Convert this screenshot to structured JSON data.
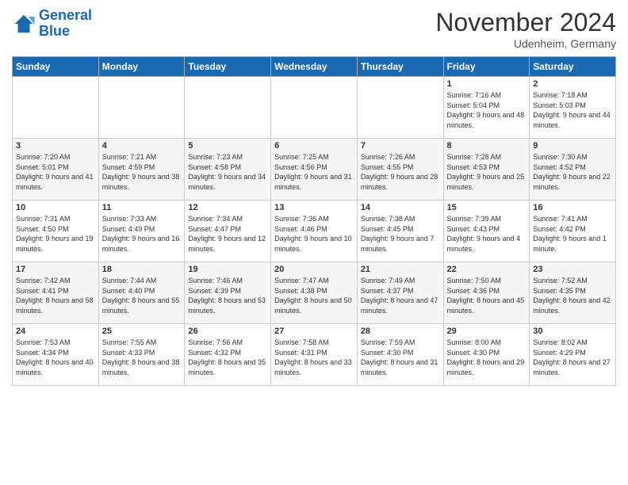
{
  "logo": {
    "line1": "General",
    "line2": "Blue"
  },
  "title": "November 2024",
  "location": "Udenheim, Germany",
  "days_of_week": [
    "Sunday",
    "Monday",
    "Tuesday",
    "Wednesday",
    "Thursday",
    "Friday",
    "Saturday"
  ],
  "weeks": [
    [
      {
        "day": "",
        "info": ""
      },
      {
        "day": "",
        "info": ""
      },
      {
        "day": "",
        "info": ""
      },
      {
        "day": "",
        "info": ""
      },
      {
        "day": "",
        "info": ""
      },
      {
        "day": "1",
        "info": "Sunrise: 7:16 AM\nSunset: 5:04 PM\nDaylight: 9 hours and 48 minutes."
      },
      {
        "day": "2",
        "info": "Sunrise: 7:18 AM\nSunset: 5:03 PM\nDaylight: 9 hours and 44 minutes."
      }
    ],
    [
      {
        "day": "3",
        "info": "Sunrise: 7:20 AM\nSunset: 5:01 PM\nDaylight: 9 hours and 41 minutes."
      },
      {
        "day": "4",
        "info": "Sunrise: 7:21 AM\nSunset: 4:59 PM\nDaylight: 9 hours and 38 minutes."
      },
      {
        "day": "5",
        "info": "Sunrise: 7:23 AM\nSunset: 4:58 PM\nDaylight: 9 hours and 34 minutes."
      },
      {
        "day": "6",
        "info": "Sunrise: 7:25 AM\nSunset: 4:56 PM\nDaylight: 9 hours and 31 minutes."
      },
      {
        "day": "7",
        "info": "Sunrise: 7:26 AM\nSunset: 4:55 PM\nDaylight: 9 hours and 28 minutes."
      },
      {
        "day": "8",
        "info": "Sunrise: 7:28 AM\nSunset: 4:53 PM\nDaylight: 9 hours and 25 minutes."
      },
      {
        "day": "9",
        "info": "Sunrise: 7:30 AM\nSunset: 4:52 PM\nDaylight: 9 hours and 22 minutes."
      }
    ],
    [
      {
        "day": "10",
        "info": "Sunrise: 7:31 AM\nSunset: 4:50 PM\nDaylight: 9 hours and 19 minutes."
      },
      {
        "day": "11",
        "info": "Sunrise: 7:33 AM\nSunset: 4:49 PM\nDaylight: 9 hours and 16 minutes."
      },
      {
        "day": "12",
        "info": "Sunrise: 7:34 AM\nSunset: 4:47 PM\nDaylight: 9 hours and 12 minutes."
      },
      {
        "day": "13",
        "info": "Sunrise: 7:36 AM\nSunset: 4:46 PM\nDaylight: 9 hours and 10 minutes."
      },
      {
        "day": "14",
        "info": "Sunrise: 7:38 AM\nSunset: 4:45 PM\nDaylight: 9 hours and 7 minutes."
      },
      {
        "day": "15",
        "info": "Sunrise: 7:39 AM\nSunset: 4:43 PM\nDaylight: 9 hours and 4 minutes."
      },
      {
        "day": "16",
        "info": "Sunrise: 7:41 AM\nSunset: 4:42 PM\nDaylight: 9 hours and 1 minute."
      }
    ],
    [
      {
        "day": "17",
        "info": "Sunrise: 7:42 AM\nSunset: 4:41 PM\nDaylight: 8 hours and 58 minutes."
      },
      {
        "day": "18",
        "info": "Sunrise: 7:44 AM\nSunset: 4:40 PM\nDaylight: 8 hours and 55 minutes."
      },
      {
        "day": "19",
        "info": "Sunrise: 7:46 AM\nSunset: 4:39 PM\nDaylight: 8 hours and 53 minutes."
      },
      {
        "day": "20",
        "info": "Sunrise: 7:47 AM\nSunset: 4:38 PM\nDaylight: 8 hours and 50 minutes."
      },
      {
        "day": "21",
        "info": "Sunrise: 7:49 AM\nSunset: 4:37 PM\nDaylight: 8 hours and 47 minutes."
      },
      {
        "day": "22",
        "info": "Sunrise: 7:50 AM\nSunset: 4:36 PM\nDaylight: 8 hours and 45 minutes."
      },
      {
        "day": "23",
        "info": "Sunrise: 7:52 AM\nSunset: 4:35 PM\nDaylight: 8 hours and 42 minutes."
      }
    ],
    [
      {
        "day": "24",
        "info": "Sunrise: 7:53 AM\nSunset: 4:34 PM\nDaylight: 8 hours and 40 minutes."
      },
      {
        "day": "25",
        "info": "Sunrise: 7:55 AM\nSunset: 4:33 PM\nDaylight: 8 hours and 38 minutes."
      },
      {
        "day": "26",
        "info": "Sunrise: 7:56 AM\nSunset: 4:32 PM\nDaylight: 8 hours and 35 minutes."
      },
      {
        "day": "27",
        "info": "Sunrise: 7:58 AM\nSunset: 4:31 PM\nDaylight: 8 hours and 33 minutes."
      },
      {
        "day": "28",
        "info": "Sunrise: 7:59 AM\nSunset: 4:30 PM\nDaylight: 8 hours and 31 minutes."
      },
      {
        "day": "29",
        "info": "Sunrise: 8:00 AM\nSunset: 4:30 PM\nDaylight: 8 hours and 29 minutes."
      },
      {
        "day": "30",
        "info": "Sunrise: 8:02 AM\nSunset: 4:29 PM\nDaylight: 8 hours and 27 minutes."
      }
    ]
  ]
}
